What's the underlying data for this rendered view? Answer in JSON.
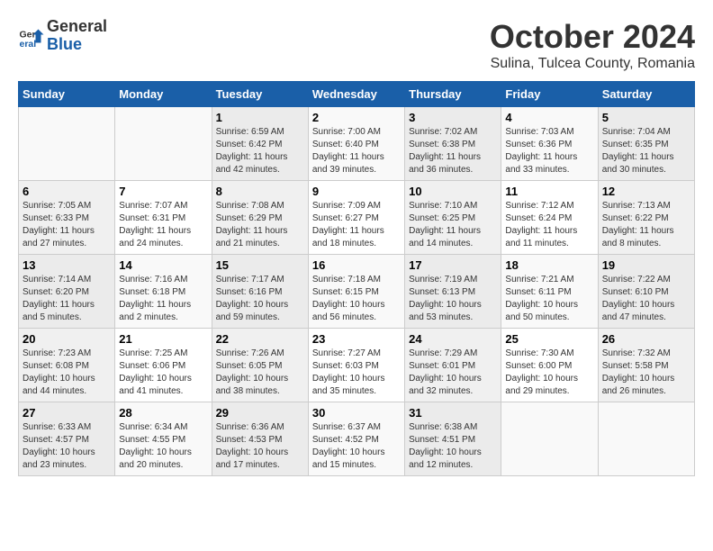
{
  "logo": {
    "general": "General",
    "blue": "Blue"
  },
  "title": "October 2024",
  "location": "Sulina, Tulcea County, Romania",
  "days_of_week": [
    "Sunday",
    "Monday",
    "Tuesday",
    "Wednesday",
    "Thursday",
    "Friday",
    "Saturday"
  ],
  "weeks": [
    [
      {
        "day": "",
        "sunrise": "",
        "sunset": "",
        "daylight": ""
      },
      {
        "day": "",
        "sunrise": "",
        "sunset": "",
        "daylight": ""
      },
      {
        "day": "1",
        "sunrise": "Sunrise: 6:59 AM",
        "sunset": "Sunset: 6:42 PM",
        "daylight": "Daylight: 11 hours and 42 minutes."
      },
      {
        "day": "2",
        "sunrise": "Sunrise: 7:00 AM",
        "sunset": "Sunset: 6:40 PM",
        "daylight": "Daylight: 11 hours and 39 minutes."
      },
      {
        "day": "3",
        "sunrise": "Sunrise: 7:02 AM",
        "sunset": "Sunset: 6:38 PM",
        "daylight": "Daylight: 11 hours and 36 minutes."
      },
      {
        "day": "4",
        "sunrise": "Sunrise: 7:03 AM",
        "sunset": "Sunset: 6:36 PM",
        "daylight": "Daylight: 11 hours and 33 minutes."
      },
      {
        "day": "5",
        "sunrise": "Sunrise: 7:04 AM",
        "sunset": "Sunset: 6:35 PM",
        "daylight": "Daylight: 11 hours and 30 minutes."
      }
    ],
    [
      {
        "day": "6",
        "sunrise": "Sunrise: 7:05 AM",
        "sunset": "Sunset: 6:33 PM",
        "daylight": "Daylight: 11 hours and 27 minutes."
      },
      {
        "day": "7",
        "sunrise": "Sunrise: 7:07 AM",
        "sunset": "Sunset: 6:31 PM",
        "daylight": "Daylight: 11 hours and 24 minutes."
      },
      {
        "day": "8",
        "sunrise": "Sunrise: 7:08 AM",
        "sunset": "Sunset: 6:29 PM",
        "daylight": "Daylight: 11 hours and 21 minutes."
      },
      {
        "day": "9",
        "sunrise": "Sunrise: 7:09 AM",
        "sunset": "Sunset: 6:27 PM",
        "daylight": "Daylight: 11 hours and 18 minutes."
      },
      {
        "day": "10",
        "sunrise": "Sunrise: 7:10 AM",
        "sunset": "Sunset: 6:25 PM",
        "daylight": "Daylight: 11 hours and 14 minutes."
      },
      {
        "day": "11",
        "sunrise": "Sunrise: 7:12 AM",
        "sunset": "Sunset: 6:24 PM",
        "daylight": "Daylight: 11 hours and 11 minutes."
      },
      {
        "day": "12",
        "sunrise": "Sunrise: 7:13 AM",
        "sunset": "Sunset: 6:22 PM",
        "daylight": "Daylight: 11 hours and 8 minutes."
      }
    ],
    [
      {
        "day": "13",
        "sunrise": "Sunrise: 7:14 AM",
        "sunset": "Sunset: 6:20 PM",
        "daylight": "Daylight: 11 hours and 5 minutes."
      },
      {
        "day": "14",
        "sunrise": "Sunrise: 7:16 AM",
        "sunset": "Sunset: 6:18 PM",
        "daylight": "Daylight: 11 hours and 2 minutes."
      },
      {
        "day": "15",
        "sunrise": "Sunrise: 7:17 AM",
        "sunset": "Sunset: 6:16 PM",
        "daylight": "Daylight: 10 hours and 59 minutes."
      },
      {
        "day": "16",
        "sunrise": "Sunrise: 7:18 AM",
        "sunset": "Sunset: 6:15 PM",
        "daylight": "Daylight: 10 hours and 56 minutes."
      },
      {
        "day": "17",
        "sunrise": "Sunrise: 7:19 AM",
        "sunset": "Sunset: 6:13 PM",
        "daylight": "Daylight: 10 hours and 53 minutes."
      },
      {
        "day": "18",
        "sunrise": "Sunrise: 7:21 AM",
        "sunset": "Sunset: 6:11 PM",
        "daylight": "Daylight: 10 hours and 50 minutes."
      },
      {
        "day": "19",
        "sunrise": "Sunrise: 7:22 AM",
        "sunset": "Sunset: 6:10 PM",
        "daylight": "Daylight: 10 hours and 47 minutes."
      }
    ],
    [
      {
        "day": "20",
        "sunrise": "Sunrise: 7:23 AM",
        "sunset": "Sunset: 6:08 PM",
        "daylight": "Daylight: 10 hours and 44 minutes."
      },
      {
        "day": "21",
        "sunrise": "Sunrise: 7:25 AM",
        "sunset": "Sunset: 6:06 PM",
        "daylight": "Daylight: 10 hours and 41 minutes."
      },
      {
        "day": "22",
        "sunrise": "Sunrise: 7:26 AM",
        "sunset": "Sunset: 6:05 PM",
        "daylight": "Daylight: 10 hours and 38 minutes."
      },
      {
        "day": "23",
        "sunrise": "Sunrise: 7:27 AM",
        "sunset": "Sunset: 6:03 PM",
        "daylight": "Daylight: 10 hours and 35 minutes."
      },
      {
        "day": "24",
        "sunrise": "Sunrise: 7:29 AM",
        "sunset": "Sunset: 6:01 PM",
        "daylight": "Daylight: 10 hours and 32 minutes."
      },
      {
        "day": "25",
        "sunrise": "Sunrise: 7:30 AM",
        "sunset": "Sunset: 6:00 PM",
        "daylight": "Daylight: 10 hours and 29 minutes."
      },
      {
        "day": "26",
        "sunrise": "Sunrise: 7:32 AM",
        "sunset": "Sunset: 5:58 PM",
        "daylight": "Daylight: 10 hours and 26 minutes."
      }
    ],
    [
      {
        "day": "27",
        "sunrise": "Sunrise: 6:33 AM",
        "sunset": "Sunset: 4:57 PM",
        "daylight": "Daylight: 10 hours and 23 minutes."
      },
      {
        "day": "28",
        "sunrise": "Sunrise: 6:34 AM",
        "sunset": "Sunset: 4:55 PM",
        "daylight": "Daylight: 10 hours and 20 minutes."
      },
      {
        "day": "29",
        "sunrise": "Sunrise: 6:36 AM",
        "sunset": "Sunset: 4:53 PM",
        "daylight": "Daylight: 10 hours and 17 minutes."
      },
      {
        "day": "30",
        "sunrise": "Sunrise: 6:37 AM",
        "sunset": "Sunset: 4:52 PM",
        "daylight": "Daylight: 10 hours and 15 minutes."
      },
      {
        "day": "31",
        "sunrise": "Sunrise: 6:38 AM",
        "sunset": "Sunset: 4:51 PM",
        "daylight": "Daylight: 10 hours and 12 minutes."
      },
      {
        "day": "",
        "sunrise": "",
        "sunset": "",
        "daylight": ""
      },
      {
        "day": "",
        "sunrise": "",
        "sunset": "",
        "daylight": ""
      }
    ]
  ]
}
